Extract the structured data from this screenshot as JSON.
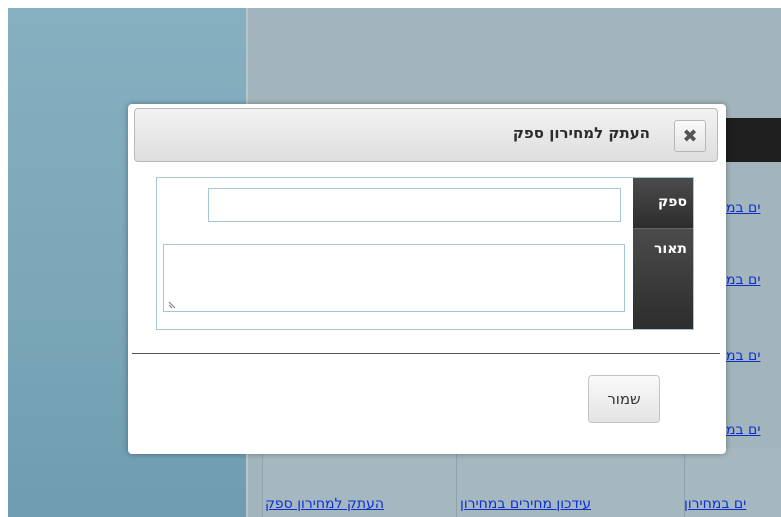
{
  "background": {
    "side_links": [
      "ים במ",
      "ים במ",
      "ים במ",
      "ים במ"
    ],
    "grid_links": [
      "ים במחירון",
      "עידכון מחירים במחירון",
      "העתק למחירון ספק"
    ]
  },
  "dialog": {
    "title": "העתק למחירון ספק",
    "close_icon": "close-icon",
    "form": {
      "supplier_label": "ספק",
      "supplier_value": "",
      "description_label": "תאור",
      "description_value": ""
    },
    "save_label": "שמור"
  }
}
